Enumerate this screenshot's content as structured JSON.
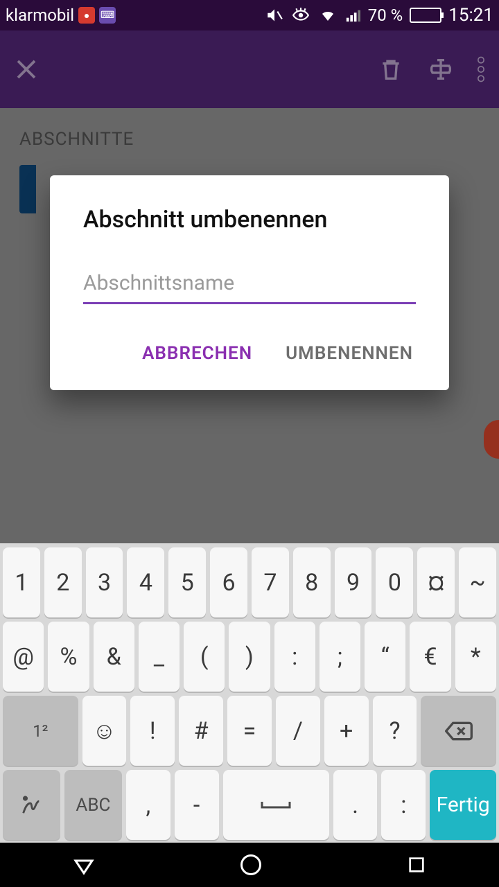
{
  "status": {
    "carrier": "klarmobil",
    "battery_pct": "70 %",
    "time": "15:21"
  },
  "content": {
    "sections_label": "ABSCHNITTE"
  },
  "dialog": {
    "title": "Abschnitt umbenennen",
    "placeholder": "Abschnittsname",
    "value": "",
    "cancel": "ABBRECHEN",
    "confirm": "UMBENENNEN"
  },
  "keyboard": {
    "row1": [
      "1",
      "2",
      "3",
      "4",
      "5",
      "6",
      "7",
      "8",
      "9",
      "0",
      "¤",
      "~"
    ],
    "row2": [
      "@",
      "%",
      "&",
      "_",
      "(",
      ")",
      ":",
      ";",
      "“",
      "€",
      "*"
    ],
    "row3_keys": [
      "☺",
      "!",
      "#",
      "=",
      "/",
      "+",
      "?"
    ],
    "row4_abc": "ABC",
    "row4_keys": [
      ",",
      "-",
      " ",
      ".",
      ":"
    ],
    "done": "Fertig",
    "shift_badge": "1²"
  }
}
